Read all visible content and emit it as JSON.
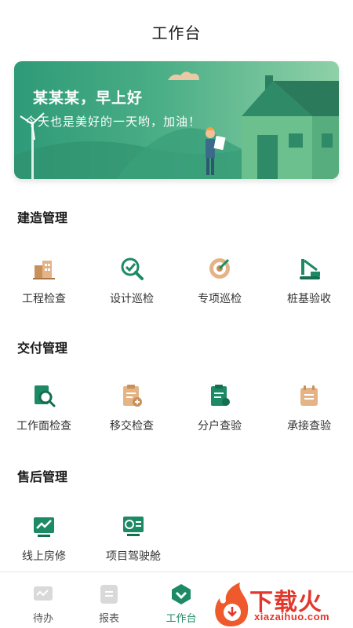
{
  "header": {
    "title": "工作台"
  },
  "banner": {
    "greeting": "某某某，早上好",
    "slogan": "今天也是美好的一天哟，加油！"
  },
  "sections": [
    {
      "title": "建造管理",
      "items": [
        {
          "label": "工程检查",
          "icon": "building-icon"
        },
        {
          "label": "设计巡检",
          "icon": "magnifier-check-icon"
        },
        {
          "label": "专项巡检",
          "icon": "target-icon"
        },
        {
          "label": "桩基验收",
          "icon": "crane-icon"
        }
      ]
    },
    {
      "title": "交付管理",
      "items": [
        {
          "label": "工作面检查",
          "icon": "doc-search-icon"
        },
        {
          "label": "移交检查",
          "icon": "clipboard-add-icon"
        },
        {
          "label": "分户查验",
          "icon": "clipboard-check-icon"
        },
        {
          "label": "承接查验",
          "icon": "notepad-icon"
        }
      ]
    },
    {
      "title": "售后管理",
      "items": [
        {
          "label": "线上房修",
          "icon": "trend-chart-icon"
        },
        {
          "label": "项目驾驶舱",
          "icon": "dashboard-monitor-icon"
        }
      ]
    }
  ],
  "tabbar": {
    "items": [
      {
        "label": "待办",
        "icon": "todo-icon",
        "active": false
      },
      {
        "label": "报表",
        "icon": "report-icon",
        "active": false
      },
      {
        "label": "工作台",
        "icon": "workbench-icon",
        "active": true
      }
    ]
  },
  "watermark": {
    "text": "下载火",
    "subtext": "xiazaihuo.com"
  },
  "colors": {
    "primary": "#1d8a66",
    "accent_brown": "#c8905a",
    "banner_green": "#3ea67f",
    "watermark_red": "#e2372b"
  }
}
